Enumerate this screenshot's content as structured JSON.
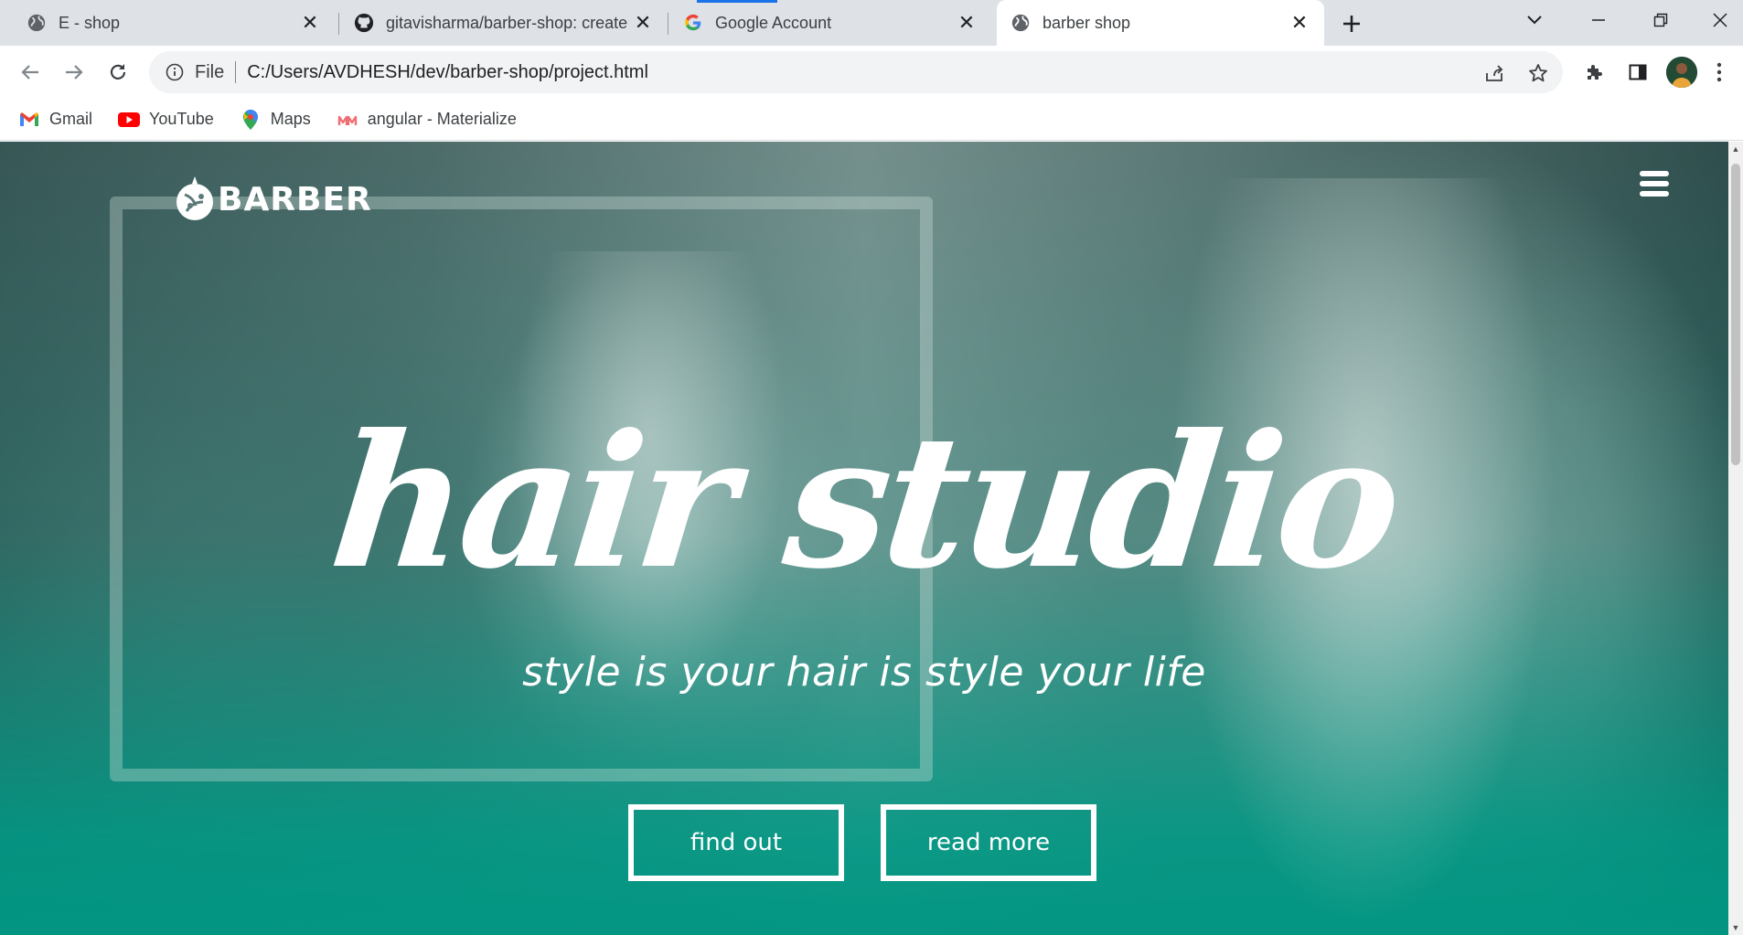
{
  "tabs": [
    {
      "title": "E - shop",
      "icon": "globe-icon"
    },
    {
      "title": "gitavisharma/barber-shop: create",
      "icon": "github-icon"
    },
    {
      "title": "Google Account",
      "icon": "google-icon"
    },
    {
      "title": "barber shop",
      "icon": "globe-icon",
      "active": true
    }
  ],
  "toolbar": {
    "scheme_label": "File",
    "url": "C:/Users/AVDHESH/dev/barber-shop/project.html"
  },
  "bookmarks": [
    {
      "label": "Gmail",
      "icon": "gmail-icon"
    },
    {
      "label": "YouTube",
      "icon": "youtube-icon"
    },
    {
      "label": "Maps",
      "icon": "maps-icon"
    },
    {
      "label": "angular - Materialize",
      "icon": "materialize-icon"
    }
  ],
  "page": {
    "logo_text": "BARBER",
    "hero_title": "hair studio",
    "hero_subtitle": "style is your hair is style your life",
    "buttons": {
      "find_out": "find out",
      "read_more": "read more"
    }
  },
  "colors": {
    "accent_teal": "#009688",
    "tab_strip": "#dee1e6",
    "loading_blue": "#1a73e8"
  }
}
